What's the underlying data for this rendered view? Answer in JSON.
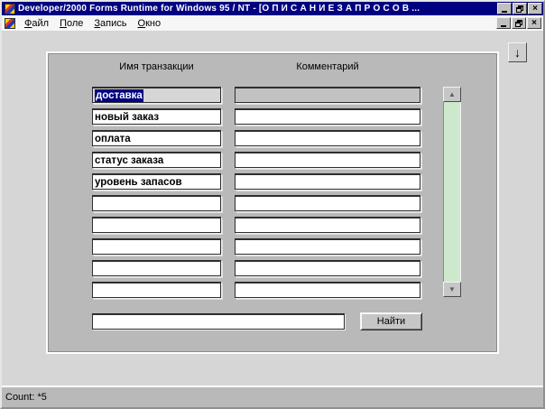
{
  "titlebar": {
    "title": "Developer/2000 Forms Runtime for Windows 95 / NT - [О П И С А Н И Е    З А П Р О С О В    ...",
    "close_glyph": "×"
  },
  "menubar": {
    "items": [
      {
        "first": "Ф",
        "rest": "айл"
      },
      {
        "first": "П",
        "rest": "оле"
      },
      {
        "first": "З",
        "rest": "апись"
      },
      {
        "first": "О",
        "rest": "кно"
      }
    ],
    "close_glyph": "×"
  },
  "toolbar": {
    "down_button_glyph": "↓"
  },
  "form": {
    "name_column_label": "Имя транзакции",
    "comment_column_label": "Комментарий",
    "rows": [
      {
        "name": "доставка",
        "comment": "",
        "current": true
      },
      {
        "name": "новый заказ",
        "comment": ""
      },
      {
        "name": "оплата",
        "comment": ""
      },
      {
        "name": "статус заказа",
        "comment": ""
      },
      {
        "name": "уровень запасов",
        "comment": ""
      },
      {
        "name": "",
        "comment": ""
      },
      {
        "name": "",
        "comment": ""
      },
      {
        "name": "",
        "comment": ""
      },
      {
        "name": "",
        "comment": ""
      },
      {
        "name": "",
        "comment": ""
      }
    ],
    "scrollbar": {
      "up_glyph": "▲",
      "down_glyph": "▼"
    },
    "search": {
      "value": "",
      "button_label": "Найти"
    }
  },
  "statusbar": {
    "text": "Count: *5"
  },
  "colors": {
    "titlebar": "#000080",
    "selection": "#000080",
    "panel": "#b9b9b9",
    "client": "#d6d6d6",
    "scroll_track": "#cde9cd"
  }
}
